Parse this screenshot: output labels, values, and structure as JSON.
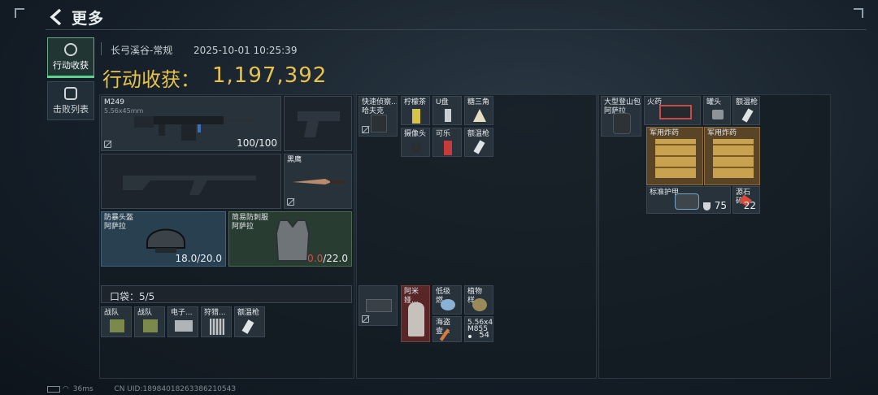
{
  "header": {
    "title": "更多"
  },
  "side_tabs": [
    {
      "label": "行动收获",
      "active": true
    },
    {
      "label": "击败列表",
      "active": false
    }
  ],
  "match": {
    "map": "长弓溪谷-常规",
    "datetime": "2025-10-01 10:25:39"
  },
  "loot": {
    "label": "行动收获：",
    "value": "1,197,392"
  },
  "equipment": {
    "primary_weapon": {
      "name": "M249",
      "ammo": "5.56x45mm",
      "durability": "100/100"
    },
    "melee": {
      "name": "黑鹰"
    },
    "helmet": {
      "name": "防暴头盔",
      "sub": "阿萨拉",
      "durability": "18.0/20.0"
    },
    "armor": {
      "name": "简易防刺服",
      "sub": "阿萨拉",
      "durability_current": "0.0",
      "durability_max": "/22.0"
    }
  },
  "pockets": {
    "label": "口袋：5/5",
    "items": [
      "战队",
      "战队",
      "电子...",
      "狩猎...",
      "额温枪"
    ]
  },
  "chest_rig": {
    "container": "快速侦察...\n哈夫克",
    "items": [
      "柠檬茶",
      "U盘",
      "糖三角",
      "摄像头",
      "可乐",
      "额温枪"
    ]
  },
  "backpack_left": {
    "items": [
      "阿米娅...",
      "低级燃...",
      "植物样...",
      "海盗壹...",
      "5.56x4..."
    ],
    "ammo_sub": "M855",
    "ammo_count": "54"
  },
  "backpack": {
    "container": "大型登山包\n阿萨拉",
    "items": [
      {
        "name": "火药"
      },
      {
        "name": "罐头"
      },
      {
        "name": "额温枪"
      },
      {
        "name": "军用炸药"
      },
      {
        "name": "军用炸药"
      },
      {
        "name": "标准护甲",
        "value": "75"
      },
      {
        "name": "源石碎...",
        "value": "22"
      }
    ]
  },
  "status": {
    "ping": "36ms",
    "uid": "CN UID:1898401826338621054З"
  }
}
